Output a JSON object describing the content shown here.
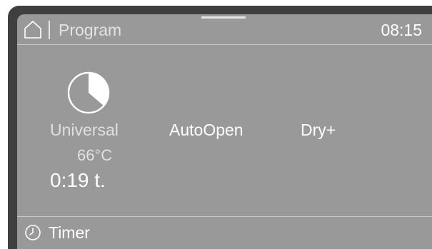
{
  "header": {
    "home_icon": "home-icon",
    "title": "Program",
    "clock": "08:15"
  },
  "program": {
    "icon": "pie-chart-icon",
    "name": "Universal",
    "temperature": "66°C",
    "duration": "0:19 t."
  },
  "options": [
    {
      "label": "AutoOpen"
    },
    {
      "label": "Dry+"
    }
  ],
  "footer": {
    "icon": "clock-icon",
    "label": "Timer"
  },
  "colors": {
    "bezel": "#3f3f3f",
    "screen": "#999999",
    "text": "#ffffff",
    "muted_text": "#e0e0e0"
  }
}
